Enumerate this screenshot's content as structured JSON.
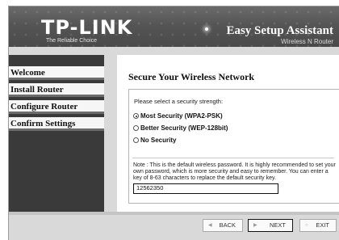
{
  "header": {
    "logo": "TP-LINK",
    "tagline": "The Reliable Choice",
    "title": "Easy Setup Assistant",
    "subtitle": "Wireless N Router"
  },
  "sidebar": {
    "items": [
      {
        "label": "Welcome"
      },
      {
        "label": "Install Router"
      },
      {
        "label": "Configure Router"
      },
      {
        "label": "Confirm Settings"
      }
    ]
  },
  "main": {
    "section_title": "Secure Your Wireless Network",
    "prompt": "Please select a security strength:",
    "options": [
      {
        "label": "Most Security (WPA2-PSK)",
        "selected": true
      },
      {
        "label": "Better Security (WEP-128bit)",
        "selected": false
      },
      {
        "label": "No Security",
        "selected": false
      }
    ],
    "note": "Note :  This is the default wireless password. It is highly recommended to set your own password, which is more security and easy to remember. You can enter a key of 8-63 characters to replace the default security key.",
    "key_value": "12562350"
  },
  "footer": {
    "back_label": "BACK",
    "next_label": "NEXT",
    "exit_label": "EXIT"
  },
  "icons": {
    "back": "back-arrow-icon",
    "next": "next-arrow-icon",
    "exit": "exit-icon"
  }
}
